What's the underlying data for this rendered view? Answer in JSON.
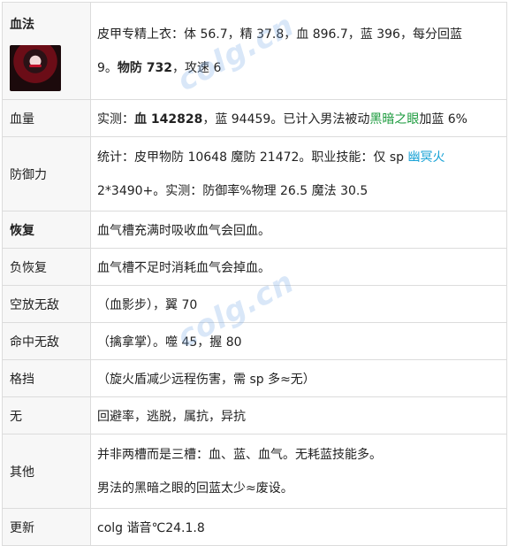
{
  "rows": [
    {
      "label": "血法",
      "line1": "皮甲专精上衣：体 56.7，精 37.8，血 896.7，蓝 396，每分回蓝",
      "line2_a": "9。",
      "line2_b": "物防 732",
      "line2_c": "，攻速 6"
    },
    {
      "label": "血量",
      "a": "实测：",
      "b": "血 142828",
      "c": "，蓝 94459。已计入男法被动",
      "d": "黑暗之眼",
      "e": "加蓝 6%"
    },
    {
      "label": "防御力",
      "line1_a": "统计：皮甲物防 10648 魔防 21472。职业技能：仅 sp ",
      "line1_b": "幽冥火",
      "line2": "2*3490+。实测：防御率%物理 26.5 魔法 30.5"
    },
    {
      "label": "恢复",
      "value": "血气槽充满时吸收血气会回血。"
    },
    {
      "label": "负恢复",
      "value": "血气槽不足时消耗血气会掉血。"
    },
    {
      "label": "空放无敌",
      "value": "（血影步），翼 70"
    },
    {
      "label": "命中无敌",
      "value": "（擒拿掌）。噬 45，握 80"
    },
    {
      "label": "格挡",
      "value": "（旋火盾减少远程伤害，需 sp 多≈无）"
    },
    {
      "label": "无",
      "value": "回避率，逃脱，属抗，异抗"
    },
    {
      "label": "其他",
      "line1": "并非两槽而是三槽：血、蓝、血气。无耗蓝技能多。",
      "line2": "男法的黑暗之眼的回蓝太少≈废设。"
    },
    {
      "label": "更新",
      "value": "colg 谐音℃24.1.8"
    }
  ],
  "watermark": "colg.cn",
  "colors": {
    "green_link": "#1a9a3c",
    "cyan_link": "#17a2d6",
    "label_bg": "#f7f7f7",
    "border": "#dcdcdc"
  }
}
